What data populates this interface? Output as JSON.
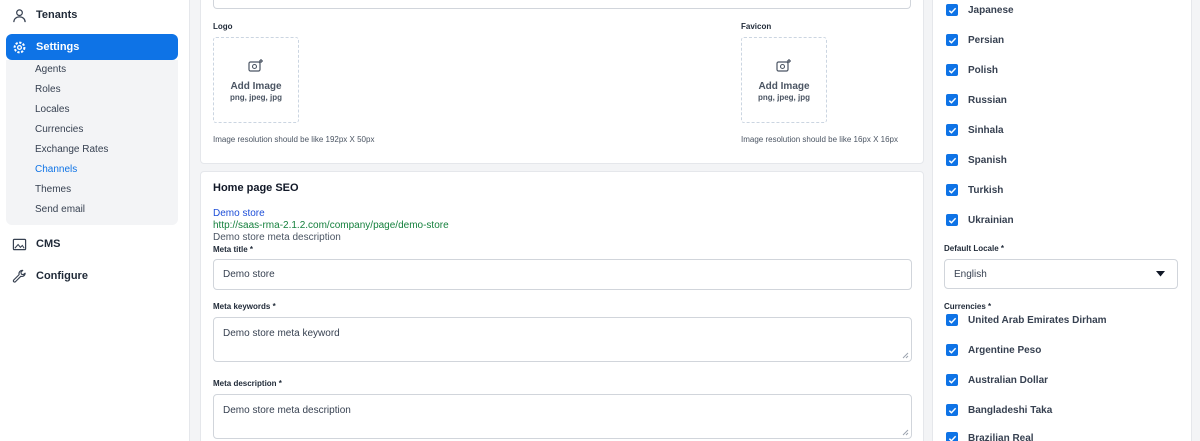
{
  "sidebar": {
    "top_items": [
      {
        "label": "Tenants",
        "icon": "user-icon"
      },
      {
        "label": "Settings",
        "icon": "gear-icon"
      }
    ],
    "settings_submenu": [
      "Agents",
      "Roles",
      "Locales",
      "Currencies",
      "Exchange Rates",
      "Channels",
      "Themes",
      "Send email"
    ],
    "bottom_items": [
      {
        "label": "CMS",
        "icon": "image-icon"
      },
      {
        "label": "Configure",
        "icon": "wrench-icon"
      }
    ]
  },
  "design": {
    "logo_label": "Logo",
    "favicon_label": "Favicon",
    "add_image": "Add Image",
    "formats": "png, jpeg, jpg",
    "logo_hint": "Image resolution should be like 192px X 50px",
    "favicon_hint": "Image resolution should be like 16px X 16px"
  },
  "seo": {
    "heading": "Home page SEO",
    "preview_title": "Demo store",
    "preview_url": "http://saas-rma-2.1.2.com/company/page/demo-store",
    "preview_description": "Demo store meta description",
    "meta_title_label": "Meta title *",
    "meta_title_value": "Demo store",
    "meta_keywords_label": "Meta keywords *",
    "meta_keywords_value": "Demo store meta keyword",
    "meta_description_label": "Meta description *",
    "meta_description_value": "Demo store meta description"
  },
  "locales": [
    "Japanese",
    "Persian",
    "Polish",
    "Russian",
    "Sinhala",
    "Spanish",
    "Turkish",
    "Ukrainian"
  ],
  "default_locale": {
    "label": "Default Locale *",
    "value": "English"
  },
  "currencies_label": "Currencies *",
  "currencies": [
    "United Arab Emirates Dirham",
    "Argentine Peso",
    "Australian Dollar",
    "Bangladeshi Taka",
    "Brazilian Real"
  ],
  "colors": {
    "accent": "#0e73e6",
    "url_green": "#15803d"
  }
}
